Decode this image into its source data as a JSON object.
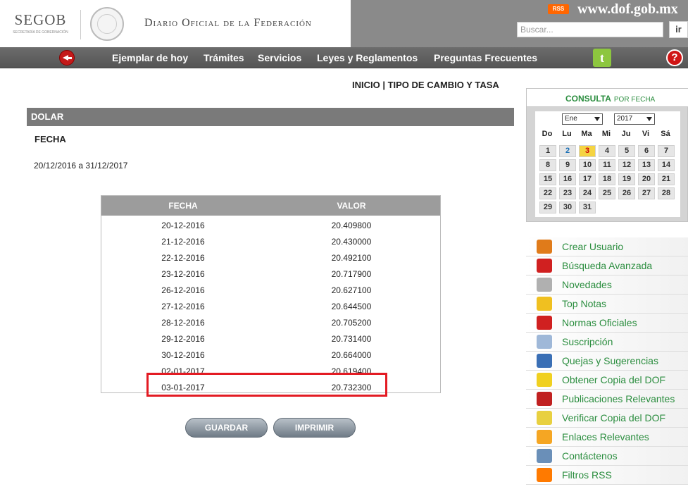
{
  "header": {
    "logo_text": "SEGOB",
    "logo_subtext": "SECRETARÍA DE GOBERNACIÓN",
    "title": "Diario Oficial de la Federación",
    "rss_label": "RSS",
    "site_url": "www.dof.gob.mx",
    "search_placeholder": "Buscar...",
    "search_button": "ir"
  },
  "nav": {
    "items": [
      "Ejemplar de hoy",
      "Trámites",
      "Servicios",
      "Leyes y Reglamentos",
      "Preguntas Frecuentes"
    ],
    "twitter_glyph": "t",
    "help_glyph": "?"
  },
  "breadcrumb": "INICIO | TIPO DE CAMBIO Y TASA",
  "section": {
    "title": "DOLAR",
    "fecha_label": "FECHA",
    "range": "20/12/2016 a 31/12/2017"
  },
  "table": {
    "headers": [
      "FECHA",
      "VALOR"
    ],
    "rows": [
      {
        "fecha": "20-12-2016",
        "valor": "20.409800"
      },
      {
        "fecha": "21-12-2016",
        "valor": "20.430000"
      },
      {
        "fecha": "22-12-2016",
        "valor": "20.492100"
      },
      {
        "fecha": "23-12-2016",
        "valor": "20.717900"
      },
      {
        "fecha": "26-12-2016",
        "valor": "20.627100"
      },
      {
        "fecha": "27-12-2016",
        "valor": "20.644500"
      },
      {
        "fecha": "28-12-2016",
        "valor": "20.705200"
      },
      {
        "fecha": "29-12-2016",
        "valor": "20.731400"
      },
      {
        "fecha": "30-12-2016",
        "valor": "20.664000"
      },
      {
        "fecha": "02-01-2017",
        "valor": "20.619400"
      },
      {
        "fecha": "03-01-2017",
        "valor": "20.732300"
      }
    ],
    "highlight_color": "#e31b23"
  },
  "buttons": {
    "save": "GUARDAR",
    "print": "IMPRIMIR"
  },
  "calendar": {
    "title": "CONSULTA",
    "subtitle": "POR FECHA",
    "month": "Ene",
    "year": "2017",
    "weekdays": [
      "Do",
      "Lu",
      "Ma",
      "Mi",
      "Ju",
      "Vi",
      "Sá"
    ],
    "days": [
      "1",
      "2",
      "3",
      "4",
      "5",
      "6",
      "7",
      "8",
      "9",
      "10",
      "11",
      "12",
      "13",
      "14",
      "15",
      "16",
      "17",
      "18",
      "19",
      "20",
      "21",
      "22",
      "23",
      "24",
      "25",
      "26",
      "27",
      "28",
      "29",
      "30",
      "31"
    ],
    "today": "3",
    "linked_day": "2"
  },
  "side_menu": {
    "items": [
      {
        "label": "Crear Usuario",
        "icon": "user-add-icon",
        "color": "#e07b1a"
      },
      {
        "label": "Búsqueda Avanzada",
        "icon": "search-icon",
        "color": "#d02020"
      },
      {
        "label": "Novedades",
        "icon": "news-icon",
        "color": "#b0b0b0"
      },
      {
        "label": "Top Notas",
        "icon": "star-icon",
        "color": "#f0c020"
      },
      {
        "label": "Normas Oficiales",
        "icon": "nom-icon",
        "color": "#d02020"
      },
      {
        "label": "Suscripción",
        "icon": "pencil-note-icon",
        "color": "#9fb8d8"
      },
      {
        "label": "Quejas y Sugerencias",
        "icon": "mailbox-icon",
        "color": "#3a6fb5"
      },
      {
        "label": "Obtener Copia del DOF",
        "icon": "document-icon",
        "color": "#f0d020"
      },
      {
        "label": "Publicaciones Relevantes",
        "icon": "newspaper-icon",
        "color": "#c02020"
      },
      {
        "label": "Verificar Copia del DOF",
        "icon": "check-document-icon",
        "color": "#e8d040"
      },
      {
        "label": "Enlaces Relevantes",
        "icon": "star-link-icon",
        "color": "#f5a623"
      },
      {
        "label": "Contáctenos",
        "icon": "contact-card-icon",
        "color": "#6a8fb8"
      },
      {
        "label": "Filtros RSS",
        "icon": "rss-icon",
        "color": "#ff7a00"
      }
    ]
  }
}
